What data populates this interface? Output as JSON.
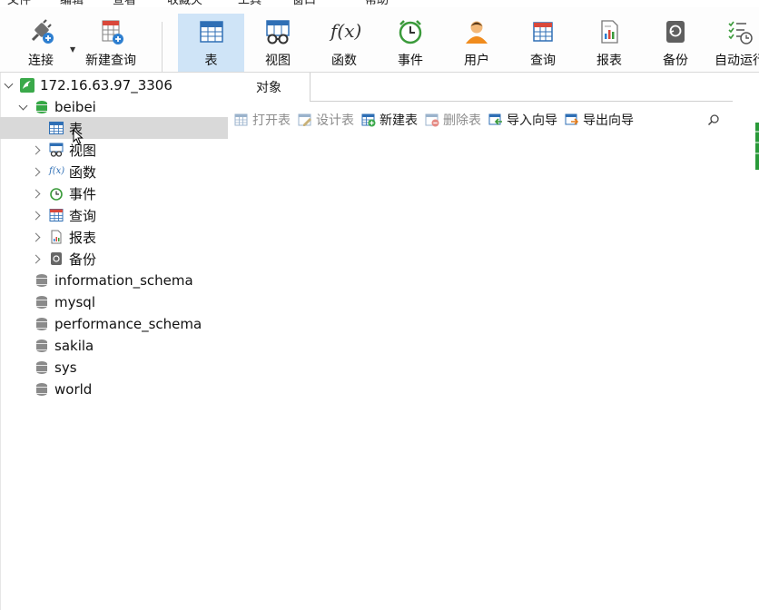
{
  "menu": [
    "文件",
    "编辑",
    "查看",
    "收藏夹",
    "工具",
    "窗口",
    "帮助"
  ],
  "toolbar": {
    "buttons": [
      {
        "label": "连接"
      },
      {
        "label": "新建查询"
      },
      {
        "label": "表"
      },
      {
        "label": "视图"
      },
      {
        "label": "函数"
      },
      {
        "label": "事件"
      },
      {
        "label": "用户"
      },
      {
        "label": "查询"
      },
      {
        "label": "报表"
      },
      {
        "label": "备份"
      },
      {
        "label": "自动运行"
      }
    ],
    "function_glyph": "f(x)"
  },
  "tree": {
    "connection": "172.16.63.97_3306",
    "database": "beibei",
    "children": [
      {
        "label": "表"
      },
      {
        "label": "视图"
      },
      {
        "label": "函数"
      },
      {
        "label": "事件"
      },
      {
        "label": "查询"
      },
      {
        "label": "报表"
      },
      {
        "label": "备份"
      }
    ],
    "other_databases": [
      {
        "label": "information_schema"
      },
      {
        "label": "mysql"
      },
      {
        "label": "performance_schema"
      },
      {
        "label": "sakila"
      },
      {
        "label": "sys"
      },
      {
        "label": "world"
      }
    ]
  },
  "main": {
    "tab_label": "对象",
    "actions": [
      {
        "label": "打开表"
      },
      {
        "label": "设计表"
      },
      {
        "label": "新建表"
      },
      {
        "label": "删除表"
      },
      {
        "label": "导入向导"
      },
      {
        "label": "导出向导"
      }
    ]
  },
  "colors": {
    "accent_selected": "#cfe4f7",
    "tree_selected": "#d9d9d9",
    "db_green": "#35a845"
  }
}
